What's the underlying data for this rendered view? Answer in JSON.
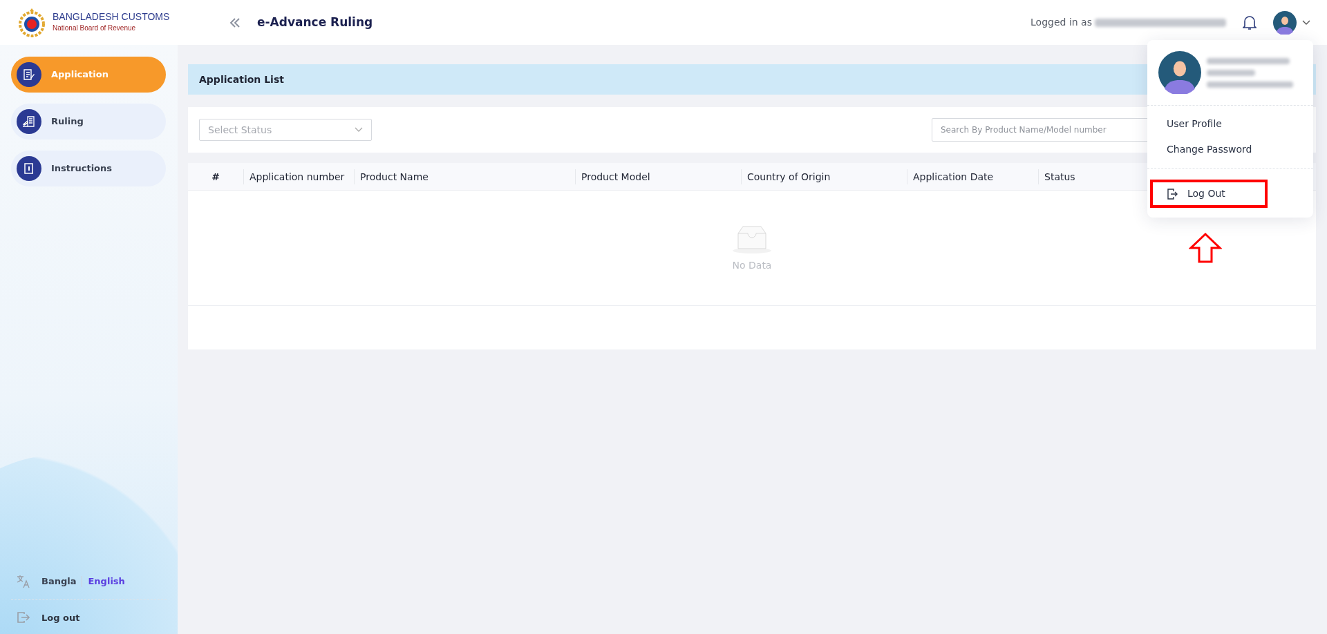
{
  "header": {
    "brand_title": "BANGLADESH CUSTOMS",
    "brand_subtitle": "National Board of Revenue",
    "app_title": "e-Advance Ruling",
    "logged_in_label": "Logged in as"
  },
  "sidebar": {
    "items": [
      {
        "label": "Application",
        "selected": true
      },
      {
        "label": "Ruling",
        "selected": false
      },
      {
        "label": "Instructions",
        "selected": false
      }
    ],
    "languages": [
      {
        "label": "Bangla",
        "selected": false
      },
      {
        "label": "English",
        "selected": true
      }
    ],
    "logout": "Log out"
  },
  "page": {
    "title": "Application List",
    "status_select": {
      "placeholder": "Select Status"
    },
    "search": {
      "placeholder": "Search By Product Name/Model number"
    }
  },
  "table": {
    "columns": [
      "#",
      "Application number",
      "Product Name",
      "Product Model",
      "Country of Origin",
      "Application Date",
      "Status"
    ],
    "empty_text": "No Data"
  },
  "user_menu": {
    "items": [
      "User Profile",
      "Change Password"
    ],
    "logout": "Log Out"
  }
}
